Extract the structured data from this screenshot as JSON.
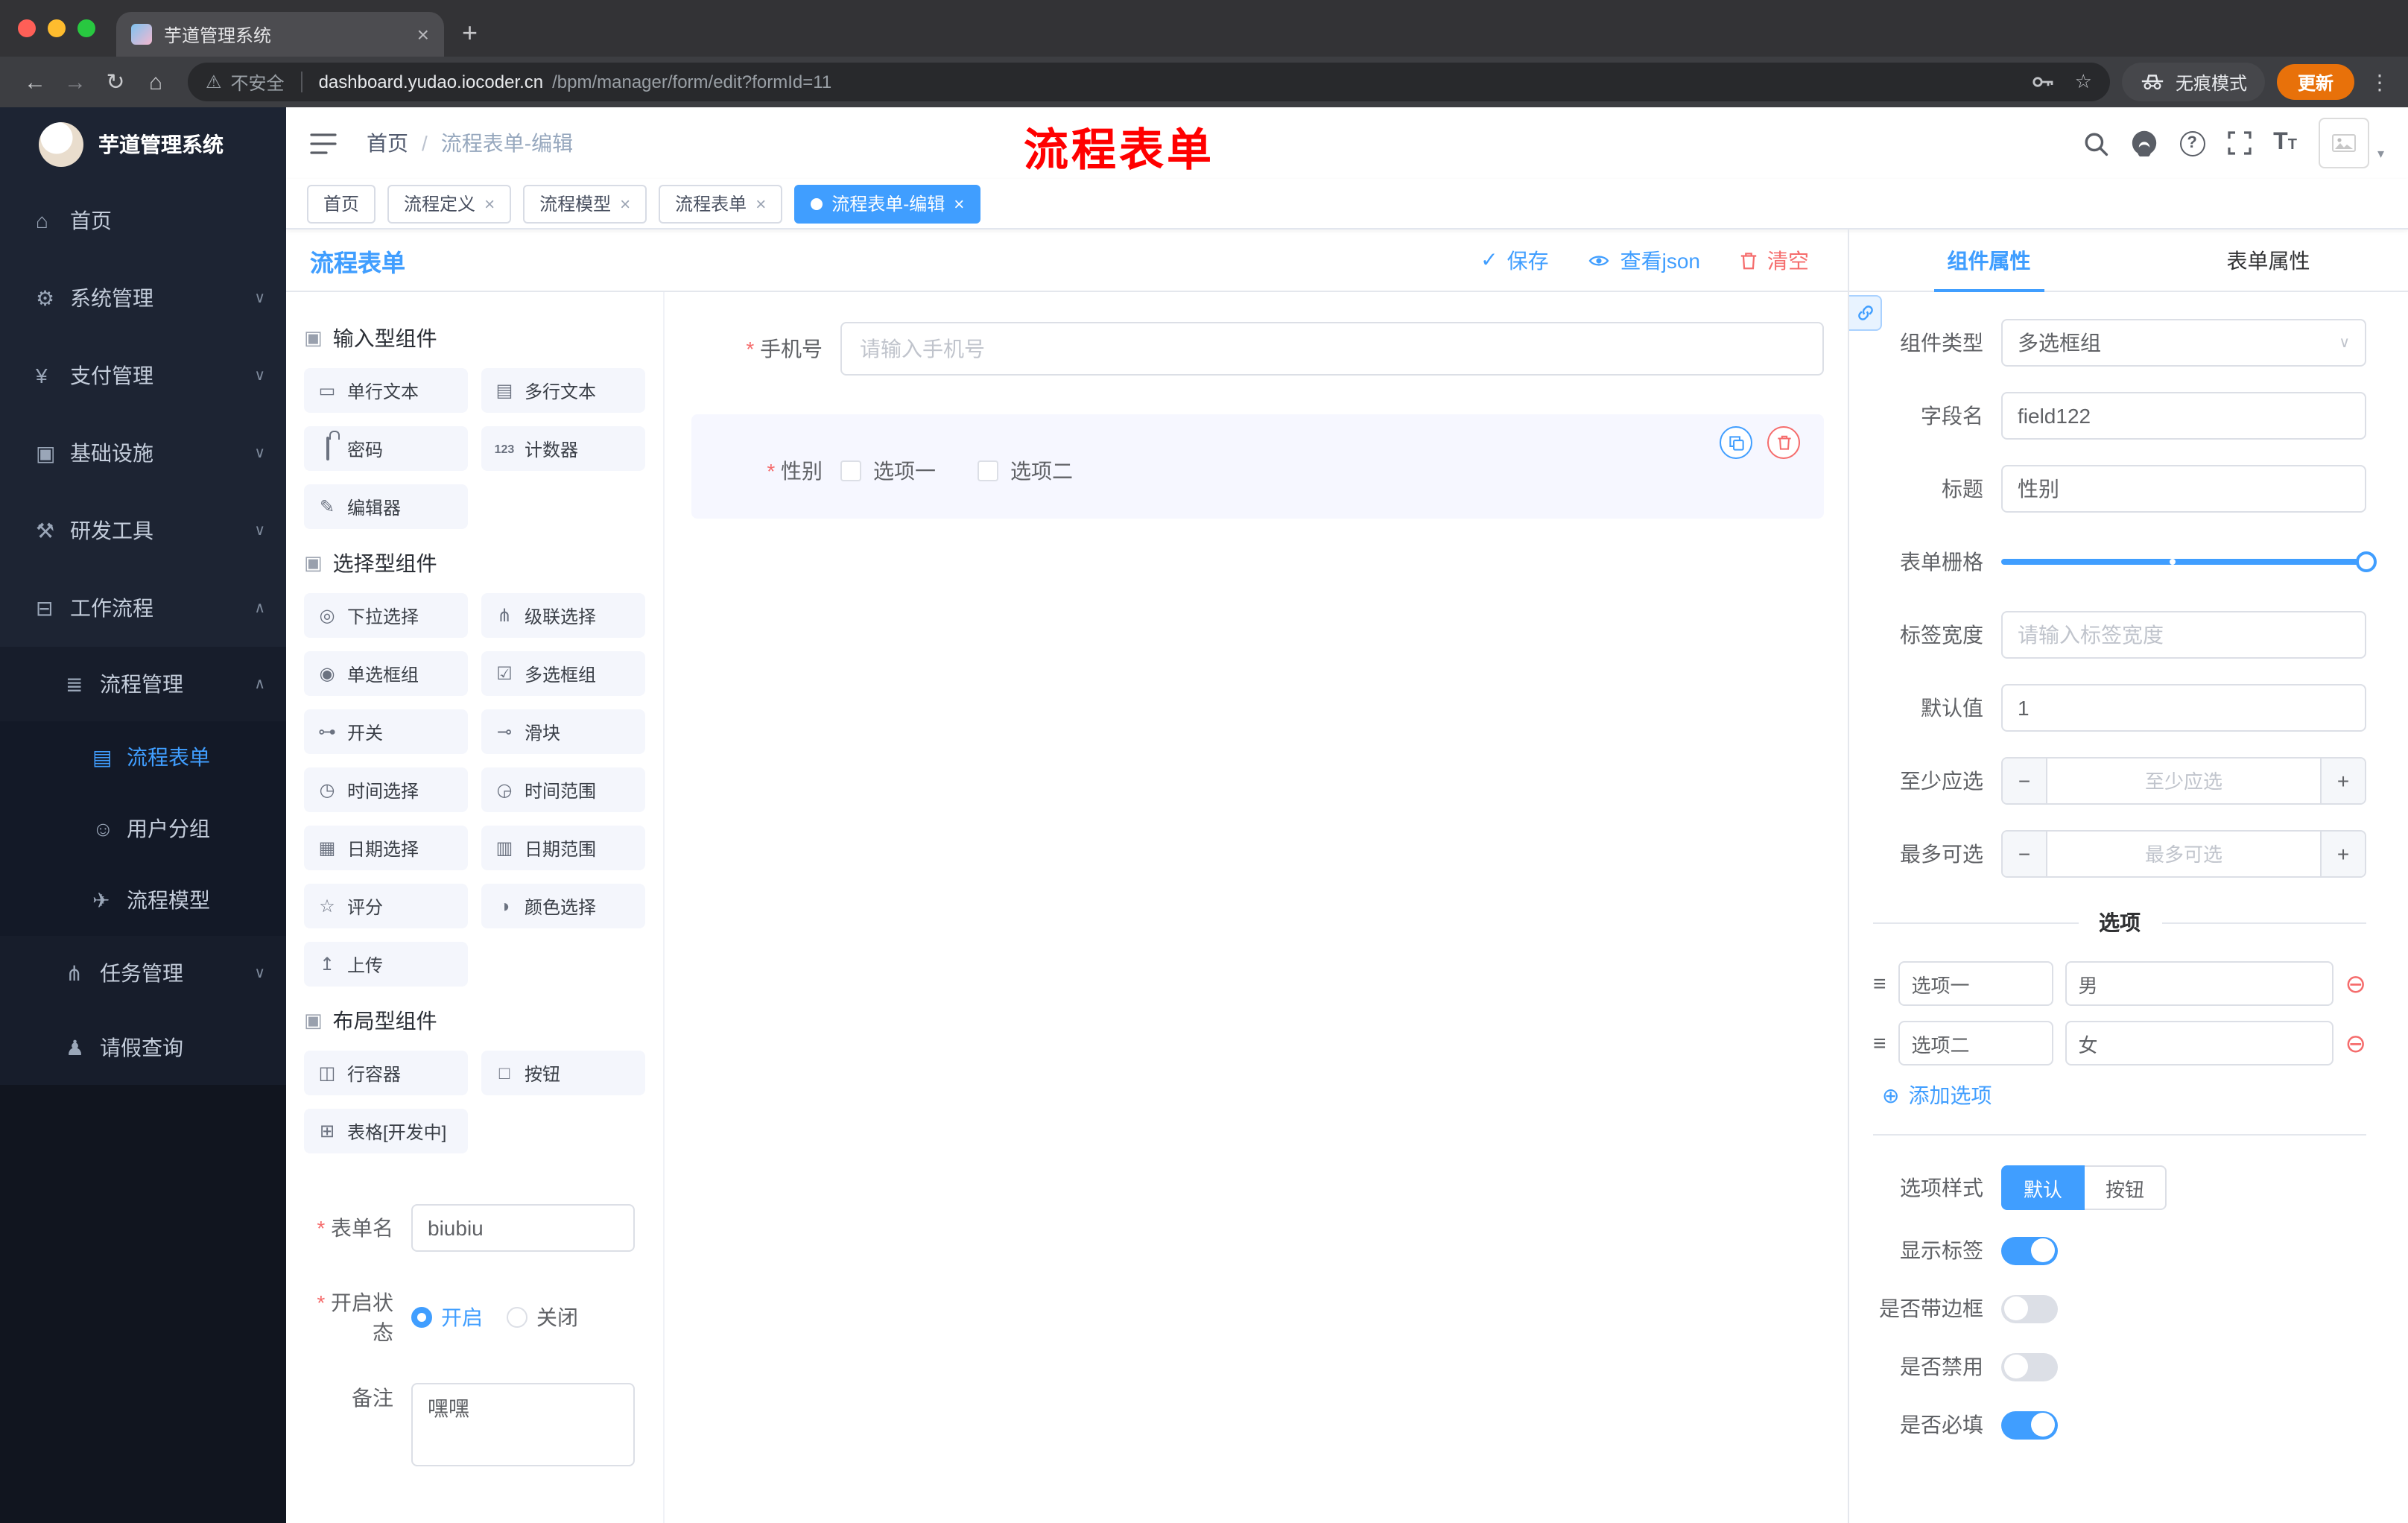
{
  "colors": {
    "accent": "#409eff",
    "danger": "#f56c6c",
    "annotation_red": "#ff0000"
  },
  "icons": {
    "warning": "⚠",
    "star": "☆",
    "close_x": "×",
    "back": "←",
    "forward": "→",
    "reload": "↻",
    "home_nav": "⌂",
    "dots": "⋮",
    "plus_tab": "+",
    "home": "⌂",
    "gear": "⚙",
    "yen": "¥",
    "infra": "▣",
    "tools": "⚒",
    "workflow": "⊟",
    "list": "≣",
    "doc": "▤",
    "users": "☺",
    "plane": "✈",
    "branch": "⋔",
    "person": "♟",
    "chev_down": "∨",
    "chev_up": "∧",
    "section": "▣",
    "text_field": "▭",
    "textarea": "▤",
    "counter": "123",
    "editor": "✎",
    "select": "◎",
    "cascader": "⋔",
    "radio": "◉",
    "checkbox": "☑",
    "toggle": "⊶",
    "slider": "⊸",
    "time": "◷",
    "time_range": "◶",
    "date": "▦",
    "date_range": "▥",
    "rate": "☆",
    "color": "◑",
    "upload": "↥",
    "row": "◫",
    "button": "□",
    "table": "⊞",
    "check": "✓",
    "question": "?",
    "font_size": "T",
    "add": "⊕",
    "remove": "⊖",
    "drag": "≡",
    "minus": "−",
    "plus": "+",
    "caret_down": "▾"
  },
  "browser": {
    "tab_title": "芋道管理系统",
    "security_label": "不安全",
    "url_host": "dashboard.yudao.iocoder.cn",
    "url_path": "/bpm/manager/form/edit?formId=11",
    "incognito_label": "无痕模式",
    "update_label": "更新"
  },
  "sidebar": {
    "logo_title": "芋道管理系统",
    "items": [
      {
        "label": "首页"
      },
      {
        "label": "系统管理"
      },
      {
        "label": "支付管理"
      },
      {
        "label": "基础设施"
      },
      {
        "label": "研发工具"
      },
      {
        "label": "工作流程"
      }
    ],
    "submenu": {
      "label": "流程管理",
      "children": [
        {
          "label": "流程表单",
          "active": true
        },
        {
          "label": "用户分组"
        },
        {
          "label": "流程模型"
        }
      ]
    },
    "items_after": [
      {
        "label": "任务管理"
      },
      {
        "label": "请假查询"
      }
    ]
  },
  "header": {
    "breadcrumb": [
      "首页",
      "流程表单-编辑"
    ],
    "separator": "/",
    "annotation": "流程表单"
  },
  "tags": [
    {
      "label": "首页"
    },
    {
      "label": "流程定义"
    },
    {
      "label": "流程模型"
    },
    {
      "label": "流程表单"
    },
    {
      "label": "流程表单-编辑"
    }
  ],
  "designer": {
    "title": "流程表单",
    "actions": {
      "save": "保存",
      "view_json": "查看json",
      "clear": "清空"
    },
    "palette": {
      "sections": [
        {
          "title": "输入型组件",
          "items": [
            {
              "label": "单行文本"
            },
            {
              "label": "多行文本"
            },
            {
              "label": "密码"
            },
            {
              "label": "计数器"
            },
            {
              "label": "编辑器"
            }
          ]
        },
        {
          "title": "选择型组件",
          "items": [
            {
              "label": "下拉选择"
            },
            {
              "label": "级联选择"
            },
            {
              "label": "单选框组"
            },
            {
              "label": "多选框组"
            },
            {
              "label": "开关"
            },
            {
              "label": "滑块"
            },
            {
              "label": "时间选择"
            },
            {
              "label": "时间范围"
            },
            {
              "label": "日期选择"
            },
            {
              "label": "日期范围"
            },
            {
              "label": "评分"
            },
            {
              "label": "颜色选择"
            },
            {
              "label": "上传"
            }
          ]
        },
        {
          "title": "布局型组件",
          "items": [
            {
              "label": "行容器"
            },
            {
              "label": "按钮"
            },
            {
              "label": "表格[开发中]"
            }
          ]
        }
      ]
    },
    "meta": {
      "form_name_label": "表单名",
      "form_name_value": "biubiu",
      "status_label": "开启状态",
      "status_on": "开启",
      "status_off": "关闭",
      "remark_label": "备注",
      "remark_value": "嘿嘿"
    },
    "canvas": {
      "phone_label": "手机号",
      "phone_placeholder": "请输入手机号",
      "gender_label": "性别",
      "gender_options": [
        "选项一",
        "选项二"
      ]
    }
  },
  "panel": {
    "tabs": [
      "组件属性",
      "表单属性"
    ],
    "rows": {
      "component_type_label": "组件类型",
      "component_type_value": "多选框组",
      "field_name_label": "字段名",
      "field_name_value": "field122",
      "title_label": "标题",
      "title_value": "性别",
      "grid_label": "表单栅格",
      "label_width_label": "标签宽度",
      "label_width_placeholder": "请输入标签宽度",
      "default_label": "默认值",
      "default_value": "1",
      "min_label": "至少应选",
      "min_placeholder": "至少应选",
      "max_label": "最多可选",
      "max_placeholder": "最多可选"
    },
    "options": {
      "divider": "选项",
      "rows": [
        {
          "name": "选项一",
          "value": "男"
        },
        {
          "name": "选项二",
          "value": "女"
        }
      ],
      "add_label": "添加选项"
    },
    "style": {
      "option_style_label": "选项样式",
      "seg_default": "默认",
      "seg_button": "按钮",
      "toggles": [
        {
          "label": "显示标签",
          "on": true
        },
        {
          "label": "是否带边框",
          "on": false
        },
        {
          "label": "是否禁用",
          "on": false
        },
        {
          "label": "是否必填",
          "on": true
        }
      ]
    }
  }
}
